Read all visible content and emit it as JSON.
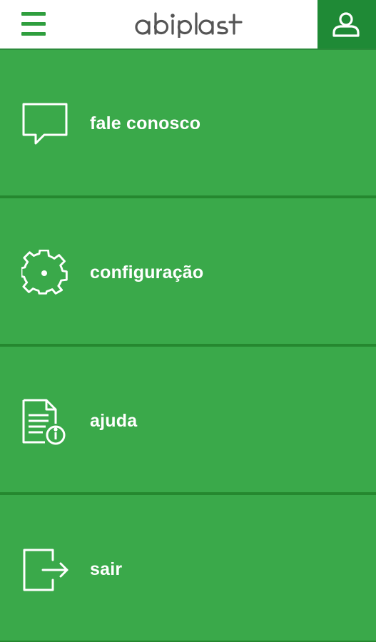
{
  "header": {
    "logo_text": "abiplast",
    "menu_icon": "hamburger-menu-icon",
    "user_icon": "user-icon"
  },
  "menu": {
    "items": [
      {
        "label": "fale conosco",
        "icon": "chat-bubble-icon"
      },
      {
        "label": "configuração",
        "icon": "gear-icon"
      },
      {
        "label": "ajuda",
        "icon": "help-document-icon"
      },
      {
        "label": "sair",
        "icon": "logout-icon"
      }
    ]
  },
  "colors": {
    "primary_green": "#3aa94a",
    "dark_green": "#1f8a36",
    "separator": "#25882f",
    "white": "#ffffff"
  }
}
